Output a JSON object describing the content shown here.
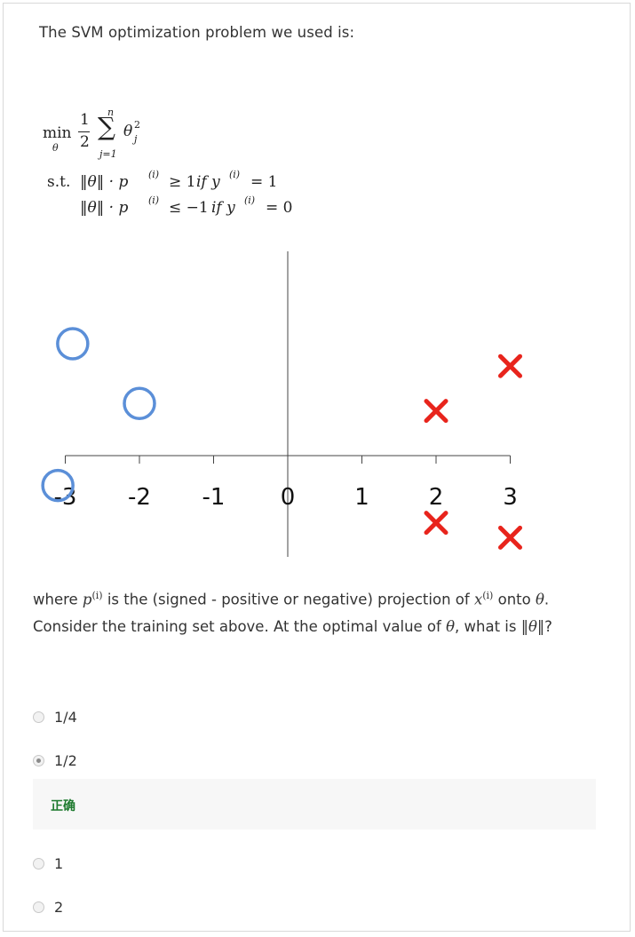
{
  "question": {
    "intro": "The SVM optimization problem we used is:",
    "formula": {
      "min": "min",
      "sub_theta": "θ",
      "frac_num": "1",
      "frac_den": "2",
      "sum_top": "n",
      "sum_sym": "∑",
      "sum_bottom": "j=1",
      "theta_j": "θ",
      "theta_sup": "2",
      "theta_sub": "j",
      "st": "s.t.",
      "c1_lhs": "‖θ‖ · p",
      "c1_sup": "(i)",
      "c1_rel": "≥ 1",
      "c1_cond": "if y",
      "c1_cond_sup": "(i)",
      "c1_cond_rhs": "= 1",
      "c2_lhs": "‖θ‖ · p",
      "c2_sup": "(i)",
      "c2_rel": "≤ −1",
      "c2_cond": "if y",
      "c2_cond_sup": "(i)",
      "c2_cond_rhs": "= 0"
    },
    "text_part1": "where ",
    "p_sym": "p",
    "p_sup": "(i)",
    "text_part2": " is the (signed - positive or negative) projection of ",
    "x_sym": "x",
    "x_sup": "(i)",
    "text_part3": " onto ",
    "theta_sym": "θ",
    "text_part4": ".",
    "line2_part1": "Consider the training set above. At the optimal value of ",
    "line2_theta": "θ",
    "line2_part2": ", what is ",
    "line2_norm": "‖θ‖",
    "line2_part3": "?"
  },
  "chart_data": {
    "type": "scatter",
    "title": "",
    "xlabel": "",
    "ylabel": "",
    "x_ticks": [
      "-3",
      "-2",
      "-1",
      "0",
      "1",
      "2",
      "3"
    ],
    "xlim": [
      -3,
      3
    ],
    "series": [
      {
        "marker": "circle",
        "color": "#5b8fd8",
        "x": [
          -2.9,
          -2.0,
          -3.1
        ],
        "y": [
          1.5,
          0.7,
          -0.4
        ]
      },
      {
        "marker": "cross",
        "color": "#e8241c",
        "x": [
          3.0,
          2.0,
          2.0,
          3.0
        ],
        "y": [
          1.2,
          0.6,
          -0.9,
          -1.1
        ]
      }
    ]
  },
  "options": [
    {
      "label": "1/4",
      "checked": false
    },
    {
      "label": "1/2",
      "checked": true
    },
    {
      "label": "1",
      "checked": false
    },
    {
      "label": "2",
      "checked": false
    }
  ],
  "feedback": {
    "text": "正确",
    "color": "#1d7a2e"
  }
}
